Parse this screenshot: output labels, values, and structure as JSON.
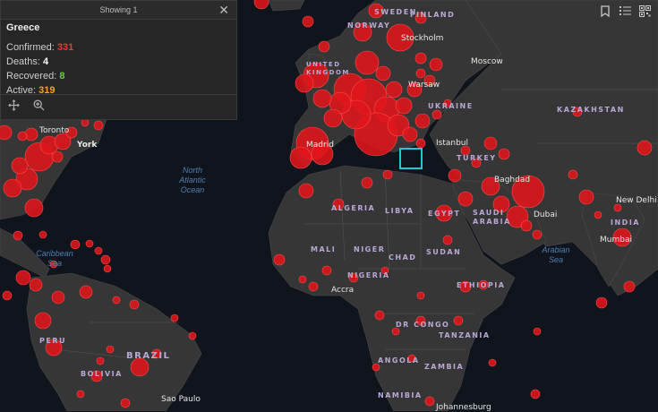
{
  "popup": {
    "header": "Showing 1",
    "country": "Greece",
    "confirmed_label": "Confirmed:",
    "confirmed": "331",
    "deaths_label": "Deaths:",
    "deaths": "4",
    "recovered_label": "Recovered:",
    "recovered": "8",
    "active_label": "Active:",
    "active": "319"
  },
  "map_labels": {
    "countries": [
      "SWEDEN",
      "FINLAND",
      "NORWAY",
      "UNITED KINGDOM",
      "UKRAINE",
      "KAZAKHSTAN",
      "TURKEY",
      "ALGERIA",
      "LIBYA",
      "EGYPT",
      "SAUDI ARABIA",
      "MALI",
      "NIGER",
      "CHAD",
      "SUDAN",
      "NIGERIA",
      "ETHIOPIA",
      "DR CONGO",
      "TANZANIA",
      "ANGOLA",
      "ZAMBIA",
      "NAMIBIA",
      "INDIA",
      "PERU",
      "BRAZIL",
      "BOLIVIA"
    ],
    "cities": [
      "Stockholm",
      "Moscow",
      "Warsaw",
      "Madrid",
      "Istanbul",
      "Baghdad",
      "Dubai",
      "New Delhi",
      "Mumbai",
      "Accra",
      "Sao Paulo",
      "York",
      "Toronto",
      "Johannesburg"
    ],
    "seas": [
      "North Atlantic Ocean",
      "Caribbean Sea",
      "Arabian Sea"
    ]
  },
  "colors": {
    "background": "#10141c",
    "land": "#363636",
    "bubble": "#e0161b",
    "selection": "#20c8d8"
  },
  "icons": [
    "close-icon",
    "move-icon",
    "zoom-icon",
    "bookmark-icon",
    "list-icon",
    "qr-icon"
  ]
}
